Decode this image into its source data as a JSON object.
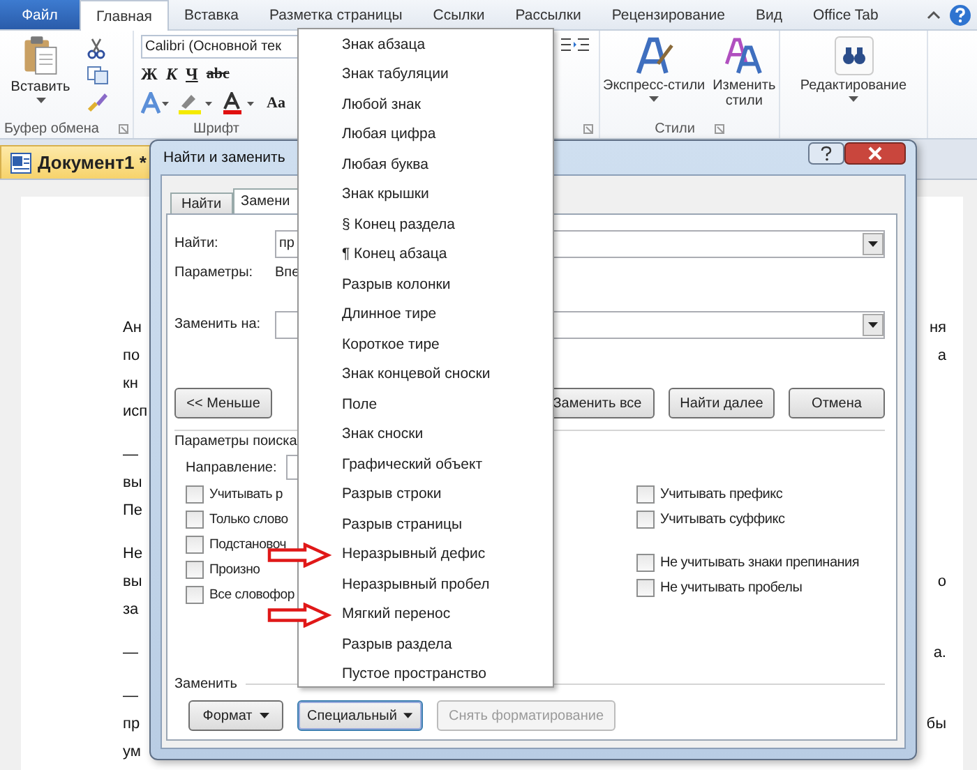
{
  "ribbon_tabs": [
    {
      "label": "Файл",
      "kind": "file",
      "selected": false
    },
    {
      "label": "Главная",
      "kind": "tab",
      "selected": true
    },
    {
      "label": "Вставка",
      "kind": "tab",
      "selected": false
    },
    {
      "label": "Разметка страницы",
      "kind": "tab",
      "selected": false
    },
    {
      "label": "Ссылки",
      "kind": "tab",
      "selected": false
    },
    {
      "label": "Рассылки",
      "kind": "tab",
      "selected": false
    },
    {
      "label": "Рецензирование",
      "kind": "tab",
      "selected": false
    },
    {
      "label": "Вид",
      "kind": "tab",
      "selected": false
    },
    {
      "label": "Office Tab",
      "kind": "tab",
      "selected": false
    }
  ],
  "ribbon": {
    "clipboard": {
      "paste": "Вставить",
      "group": "Буфер обмена"
    },
    "font": {
      "font_name": "Calibri (Основной тек",
      "format_buttons": [
        "Ж",
        "К",
        "Ч",
        "abc"
      ],
      "case_button": "Aa",
      "group": "Шрифт"
    },
    "styles": {
      "buttons": [
        "Экспресс-стили",
        "Изменить стили"
      ],
      "group": "Стили"
    },
    "editing": {
      "button": "Редактирование"
    }
  },
  "document_tab": {
    "title": "Документ1 *"
  },
  "document": {
    "paragraphs": [
      [
        {
          "left": "Ан",
          "right": "ня"
        },
        {
          "left": "по",
          "right": "а"
        },
        {
          "left": "кн"
        },
        {
          "left": "исп"
        }
      ],
      [
        {
          "left": "—"
        },
        {
          "left": "вы"
        },
        {
          "left": "Пе"
        }
      ],
      [
        {
          "left": "Не"
        },
        {
          "left": "вы",
          "right": "о"
        },
        {
          "left": "за"
        }
      ],
      [
        {
          "left": "—",
          "right": "а."
        }
      ],
      [
        {
          "left": "—"
        },
        {
          "left": "пр",
          "right": "бы"
        },
        {
          "left": "ум"
        }
      ]
    ]
  },
  "dialog": {
    "title": "Найти и заменить",
    "tabs": [
      {
        "label": "Найти",
        "selected": false
      },
      {
        "label": "Замени",
        "selected": true
      }
    ],
    "find": {
      "label": "Найти:",
      "value": "пр"
    },
    "options": {
      "label": "Параметры:",
      "value": "Впе"
    },
    "replace": {
      "label": "Заменить на:"
    },
    "less_button": "<< Меньше",
    "action_buttons": [
      "Заменить все",
      "Найти далее",
      "Отмена"
    ],
    "search_options_label": "Параметры поиска",
    "direction_label": "Направление:",
    "left_checks": [
      {
        "label": "Учитывать р",
        "checked": false
      },
      {
        "label": "Только слово",
        "checked": false
      },
      {
        "label": "Подстановоч",
        "checked": false
      },
      {
        "label": "Произно",
        "checked": false
      },
      {
        "label": "Все словофор",
        "checked": false
      }
    ],
    "right_checks": [
      {
        "label": "Учитывать префикс",
        "checked": false
      },
      {
        "label": "Учитывать суффикс",
        "checked": false
      },
      {
        "label": "Не учитывать знаки препинания",
        "checked": false
      },
      {
        "label": "Не учитывать пробелы",
        "checked": false
      }
    ],
    "replace_section": "Заменить",
    "bottom_buttons": [
      {
        "label": "Формат",
        "disabled": false,
        "dropdown": true
      },
      {
        "label": "Специальный",
        "disabled": false,
        "dropdown": true
      },
      {
        "label": "Снять форматирование",
        "disabled": true,
        "dropdown": false
      }
    ]
  },
  "special_menu": [
    {
      "label": "Знак абзаца",
      "annotated": false
    },
    {
      "label": "Знак табуляции",
      "annotated": false
    },
    {
      "label": "Любой знак",
      "annotated": false
    },
    {
      "label": "Любая цифра",
      "annotated": false
    },
    {
      "label": "Любая буква",
      "annotated": false
    },
    {
      "label": "Знак крышки",
      "annotated": false
    },
    {
      "label": "§ Конец раздела",
      "annotated": false
    },
    {
      "label": "¶ Конец абзаца",
      "annotated": false
    },
    {
      "label": "Разрыв колонки",
      "annotated": false
    },
    {
      "label": "Длинное тире",
      "annotated": false
    },
    {
      "label": "Короткое тире",
      "annotated": false
    },
    {
      "label": "Знак концевой сноски",
      "annotated": false
    },
    {
      "label": "Поле",
      "annotated": false
    },
    {
      "label": "Знак сноски",
      "annotated": false
    },
    {
      "label": "Графический объект",
      "annotated": false
    },
    {
      "label": "Разрыв строки",
      "annotated": false
    },
    {
      "label": "Разрыв страницы",
      "annotated": false
    },
    {
      "label": "Неразрывный дефис",
      "annotated": true
    },
    {
      "label": "Неразрывный пробел",
      "annotated": false
    },
    {
      "label": "Мягкий перенос",
      "annotated": true
    },
    {
      "label": "Разрыв раздела",
      "annotated": false
    },
    {
      "label": "Пустое пространство",
      "annotated": false
    }
  ]
}
